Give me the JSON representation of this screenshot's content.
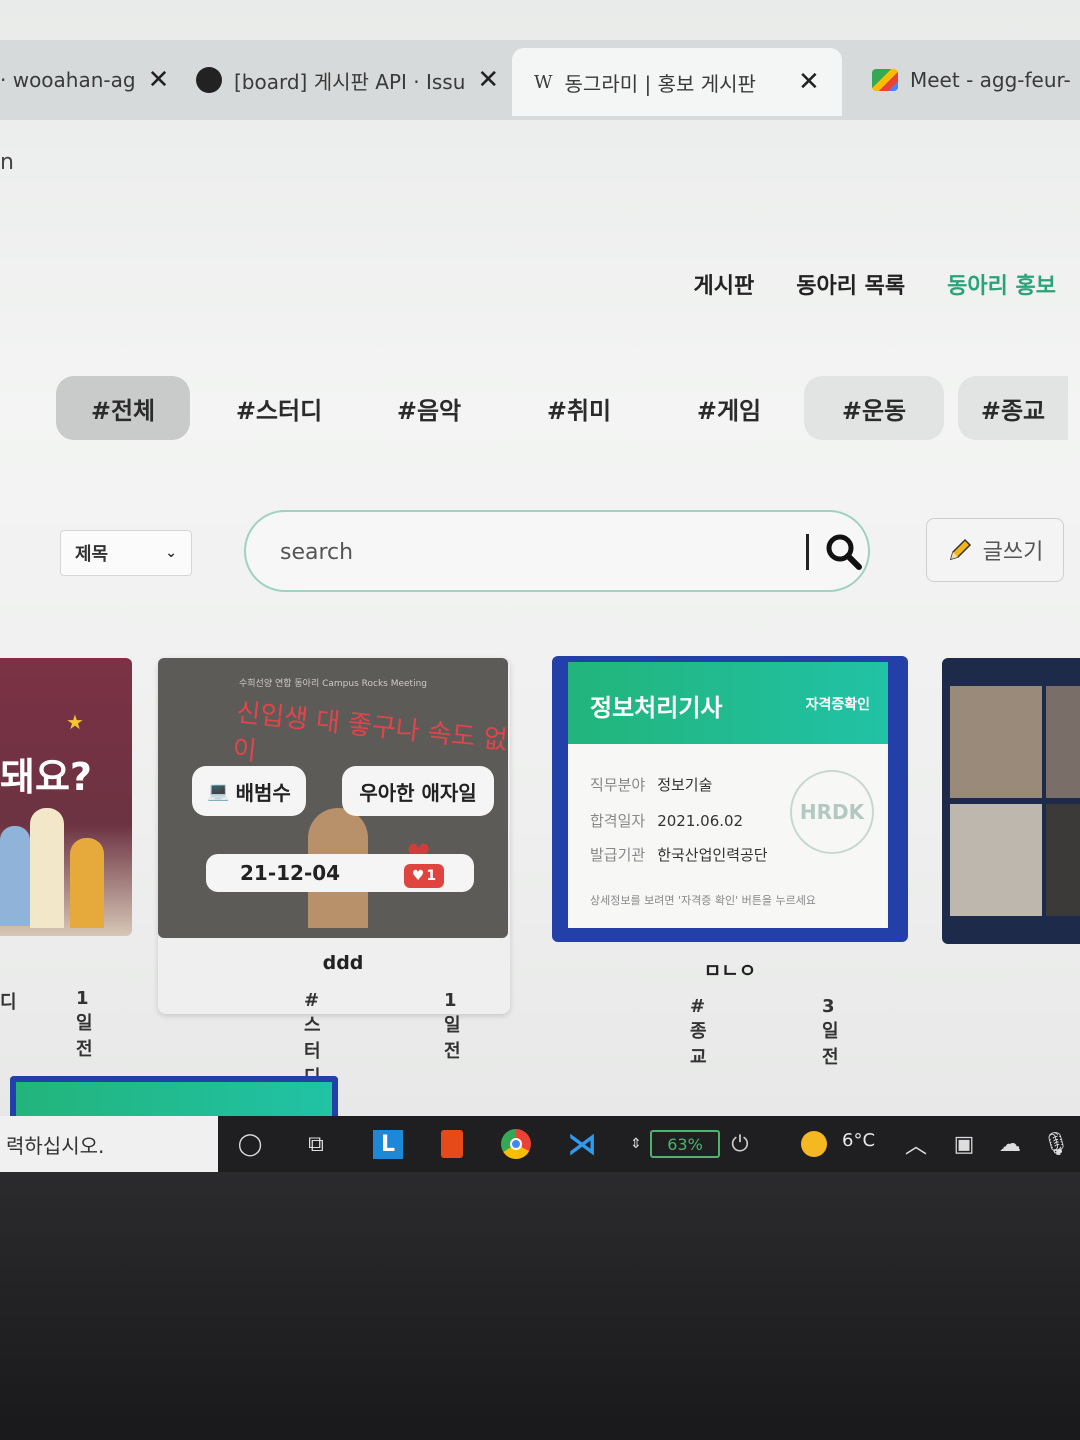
{
  "browser": {
    "tabs": [
      {
        "label": "· wooahan-ag"
      },
      {
        "label": "[board] 게시판 API · Issu"
      },
      {
        "label": "동그라미 | 홍보 게시판"
      },
      {
        "label": "Meet - agg-feur-"
      }
    ],
    "url_fragment": "n"
  },
  "nav": {
    "items": [
      "게시판",
      "동아리 목록",
      "동아리 홍보"
    ]
  },
  "categories": [
    "#전체",
    "#스터디",
    "#음악",
    "#취미",
    "#게임",
    "#운동",
    "#종교"
  ],
  "search": {
    "select_value": "제목",
    "placeholder": "search",
    "write_label": "글쓰기"
  },
  "cards": [
    {
      "thumb_text": "돼요?",
      "title": "",
      "tag": "디",
      "ago": "1일 전"
    },
    {
      "thumb_top": "수희선양 연합 동아리 Campus Rocks Meeting",
      "thumb_text": "신입생 대 좋구나 속도 없이",
      "hover_tags": [
        "배범수",
        "우아한 애자일"
      ],
      "date": "21-12-04",
      "likes": "1",
      "title": "ddd",
      "tag": "#스터디",
      "ago": "1일 전"
    },
    {
      "cert_title": "정보처리기사",
      "cert_badge": "자격증확인",
      "rows": [
        {
          "k": "직무분야",
          "v": "정보기술"
        },
        {
          "k": "합격일자",
          "v": "2021.06.02"
        },
        {
          "k": "발급기관",
          "v": "한국산업인력공단"
        }
      ],
      "note": "상세정보를 보려면 '자격증 확인' 버튼을 누르세요",
      "stamp": "HRDK",
      "title": "ㅁㄴㅇ",
      "tag": "#종교",
      "ago": "3일 전"
    }
  ],
  "taskbar": {
    "search_text": "력하십시오.",
    "battery": "63%",
    "temperature": "6°C"
  }
}
